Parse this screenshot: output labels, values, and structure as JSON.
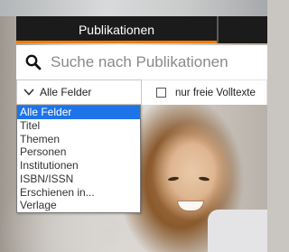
{
  "tabs": {
    "active_label": "Publikationen"
  },
  "search": {
    "placeholder": "Suche nach Publikationen",
    "icon": "search-icon"
  },
  "filters": {
    "field_select_label": "Alle Felder",
    "fulltext_checkbox_label": "nur freie Volltexte",
    "fulltext_checked": false
  },
  "dropdown": {
    "options": [
      "Alle Felder",
      "Titel",
      "Themen",
      "Personen",
      "Institutionen",
      "ISBN/ISSN",
      "Erschienen in...",
      "Verlage"
    ],
    "selected_index": 0
  },
  "colors": {
    "tab_bg": "#1b1b1b",
    "accent": "#ee7d00",
    "selection": "#1e73e8"
  }
}
